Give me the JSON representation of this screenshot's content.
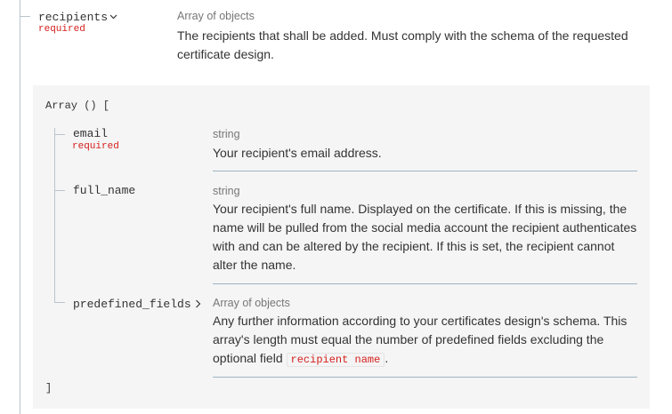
{
  "recipients": {
    "name": "recipients",
    "required": "required",
    "type": "Array of objects",
    "description": "The recipients that shall be added. Must comply with the schema of the requested certificate design."
  },
  "array_block": {
    "open": "Array () [",
    "close": "]",
    "fields": [
      {
        "name": "email",
        "required": "required",
        "type": "string",
        "description": "Your recipient's email address."
      },
      {
        "name": "full_name",
        "type": "string",
        "description": "Your recipient's full name. Displayed on the certificate. If this is missing, the name will be pulled from the social media account the recipient authenticates with and can be altered by the recipient. If this is set, the recipient cannot alter the name."
      },
      {
        "name": "predefined_fields",
        "type": "Array of objects",
        "description_prefix": "Any further information according to your certificates design's schema. This array's length must equal the number of predefined fields excluding the optional field",
        "code": "recipient name",
        "description_suffix": "."
      }
    ]
  },
  "icons": {
    "expand": "chevron-down-icon",
    "collapse": "chevron-right-icon"
  },
  "colors": {
    "required": "#d41f1c",
    "tree_line": "#b9c4cc",
    "separator": "#9fb4c2",
    "panel_bg": "#f5f5f5"
  }
}
